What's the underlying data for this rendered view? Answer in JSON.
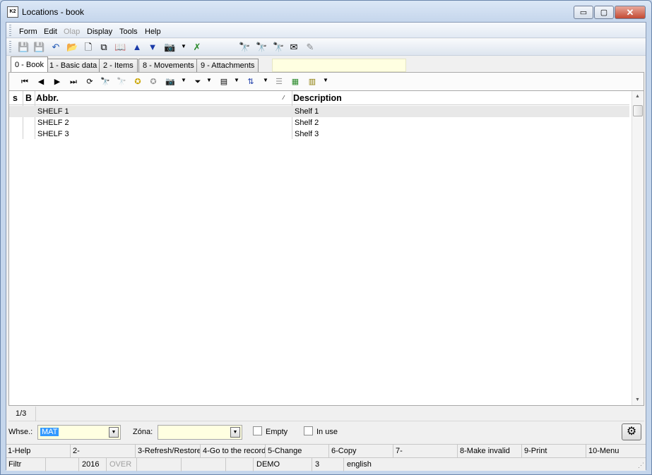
{
  "window": {
    "title": "Locations - book",
    "app_icon_text": "K2"
  },
  "window_controls": {
    "minimize": "▭",
    "maximize": "▢",
    "close": "✕"
  },
  "menu": [
    {
      "label": "Form",
      "enabled": true
    },
    {
      "label": "Edit",
      "enabled": true
    },
    {
      "label": "Olap",
      "enabled": false
    },
    {
      "label": "Display",
      "enabled": true
    },
    {
      "label": "Tools",
      "enabled": true
    },
    {
      "label": "Help",
      "enabled": true
    }
  ],
  "toolbar_icons": [
    "save-icon",
    "save-as-icon",
    "undo-icon",
    "open-folder-icon",
    "new-document-icon",
    "copy-icon",
    "book-icon",
    "arrow-up-icon",
    "arrow-down-icon",
    "camera-icon",
    "dropdown-arrow-icon",
    "export-icon",
    "binoculars-icon",
    "binoculars-next-icon",
    "binoculars-pin-icon",
    "envelope-icon",
    "pen-paper-icon"
  ],
  "tabs": [
    {
      "label": "0 - Book",
      "active": true
    },
    {
      "label": "1 - Basic data",
      "active": false
    },
    {
      "label": "2 - Items",
      "active": false
    },
    {
      "label": "8 - Movements",
      "active": false
    },
    {
      "label": "9 - Attachments",
      "active": false
    }
  ],
  "grid": {
    "columns": [
      {
        "key": "s",
        "label": "s"
      },
      {
        "key": "b",
        "label": "B"
      },
      {
        "key": "abbr",
        "label": "Abbr."
      },
      {
        "key": "description",
        "label": "Description"
      }
    ],
    "sort_indicator": "⁄",
    "rows": [
      {
        "abbr": "SHELF 1",
        "description": "Shelf 1",
        "selected": true
      },
      {
        "abbr": "SHELF 2",
        "description": "Shelf 2",
        "selected": false
      },
      {
        "abbr": "SHELF 3",
        "description": "Shelf 3",
        "selected": false
      }
    ]
  },
  "record_counter": "1/3",
  "filters": {
    "warehouse_label": "Whse.:",
    "warehouse_value": "MAT",
    "zone_label": "Zóna:",
    "zone_value": "",
    "empty_label": "Empty",
    "empty_checked": false,
    "in_use_label": "In use",
    "in_use_checked": false
  },
  "function_keys": [
    "1-Help",
    "2-",
    "3-Refresh/Restore",
    "4-Go to the record",
    "5-Change",
    "6-Copy",
    "7-",
    "8-Make invalid",
    "9-Print",
    "10-Menu"
  ],
  "status_bar": {
    "filter": "Filtr",
    "year": "2016",
    "mode": "OVER",
    "database": "DEMO",
    "number": "3",
    "language": "english"
  }
}
